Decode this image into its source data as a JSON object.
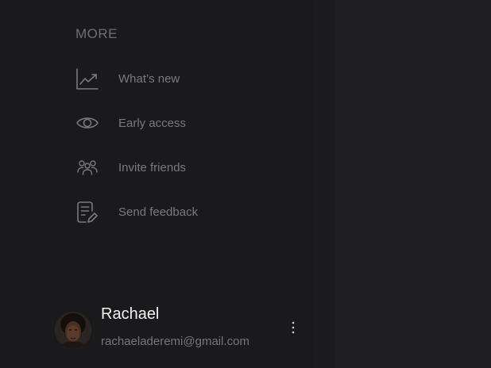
{
  "sidebar": {
    "section_heading": "MORE",
    "items": [
      {
        "label": "What’s new",
        "icon": "trending-chart-icon"
      },
      {
        "label": "Early access",
        "icon": "eye-icon"
      },
      {
        "label": "Invite friends",
        "icon": "users-group-icon"
      },
      {
        "label": "Send feedback",
        "icon": "feedback-edit-icon"
      }
    ]
  },
  "profile": {
    "name": "Rachael",
    "email": "rachaeladeremi@gmail.com",
    "more_icon": "vertical-ellipsis-icon"
  },
  "colors": {
    "sidebar_bg": "#1a1a1c",
    "main_bg": "#1f1f21",
    "muted_text": "#7a7a7e",
    "name_text": "#f2f2f2"
  }
}
